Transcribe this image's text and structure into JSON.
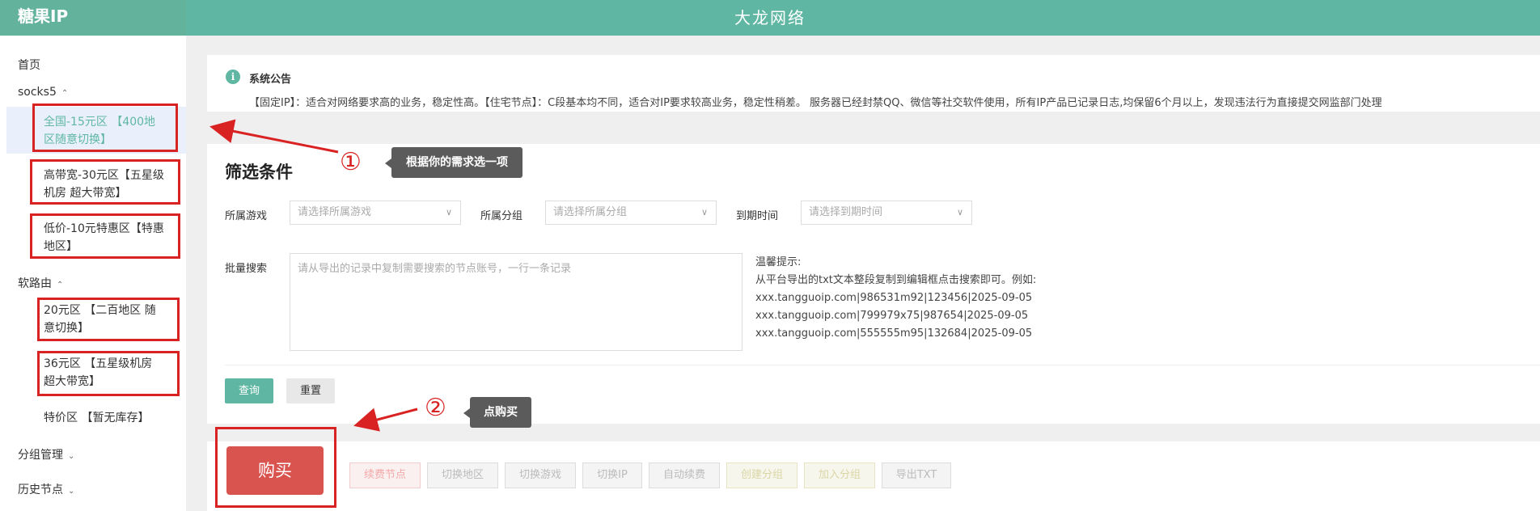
{
  "header": {
    "brand": "糖果IP",
    "title": "大龙网络"
  },
  "sidebar": {
    "home": "首页",
    "socks5": {
      "label": "socks5",
      "items": [
        "全国-15元区 【400地区随意切换】",
        "高带宽-30元区【五星级机房 超大带宽】",
        "低价-10元特惠区【特惠地区】"
      ]
    },
    "soft_router": {
      "label": "软路由",
      "items": [
        "20元区 【二百地区 随意切换】",
        "36元区 【五星级机房 超大带宽】",
        "特价区 【暂无库存】"
      ]
    },
    "group_manage": "分组管理",
    "history_nodes": "历史节点"
  },
  "notice": {
    "title": "系统公告",
    "text": "【固定IP】：适合对网络要求高的业务，稳定性高。【住宅节点】：C段基本均不同，适合对IP要求较高业务，稳定性稍差。 服务器已经封禁QQ、微信等社交软件使用，所有IP产品已记录日志,均保留6个月以上，发现违法行为直接提交网监部门处理"
  },
  "filter": {
    "title": "筛选条件",
    "game_label": "所属游戏",
    "game_placeholder": "请选择所属游戏",
    "group_label": "所属分组",
    "group_placeholder": "请选择所属分组",
    "expire_label": "到期时间",
    "expire_placeholder": "请选择到期时间",
    "batch_label": "批量搜索",
    "batch_placeholder": "请从导出的记录中复制需要搜索的节点账号，一行一条记录",
    "tips": [
      "温馨提示:",
      "从平台导出的txt文本整段复制到编辑框点击搜索即可。例如:",
      "xxx.tangguoip.com|986531m92|123456|2025-09-05",
      "xxx.tangguoip.com|799979x75|987654|2025-09-05",
      "xxx.tangguoip.com|555555m95|132684|2025-09-05"
    ],
    "query": "查询",
    "reset": "重置"
  },
  "actions": {
    "buy": "购买",
    "renew": "续费节点",
    "switch_region": "切换地区",
    "switch_game": "切换游戏",
    "switch_ip": "切换IP",
    "auto_renew": "自动续费",
    "create_group": "创建分组",
    "join_group": "加入分组",
    "export_txt": "导出TXT"
  },
  "annotations": {
    "step1": "①",
    "step1_text": "根据你的需求选一项",
    "step2": "②",
    "step2_text": "点购买",
    "color": "#d92323"
  },
  "colors": {
    "header": "#5fb7a3",
    "buy": "#d9534f"
  }
}
